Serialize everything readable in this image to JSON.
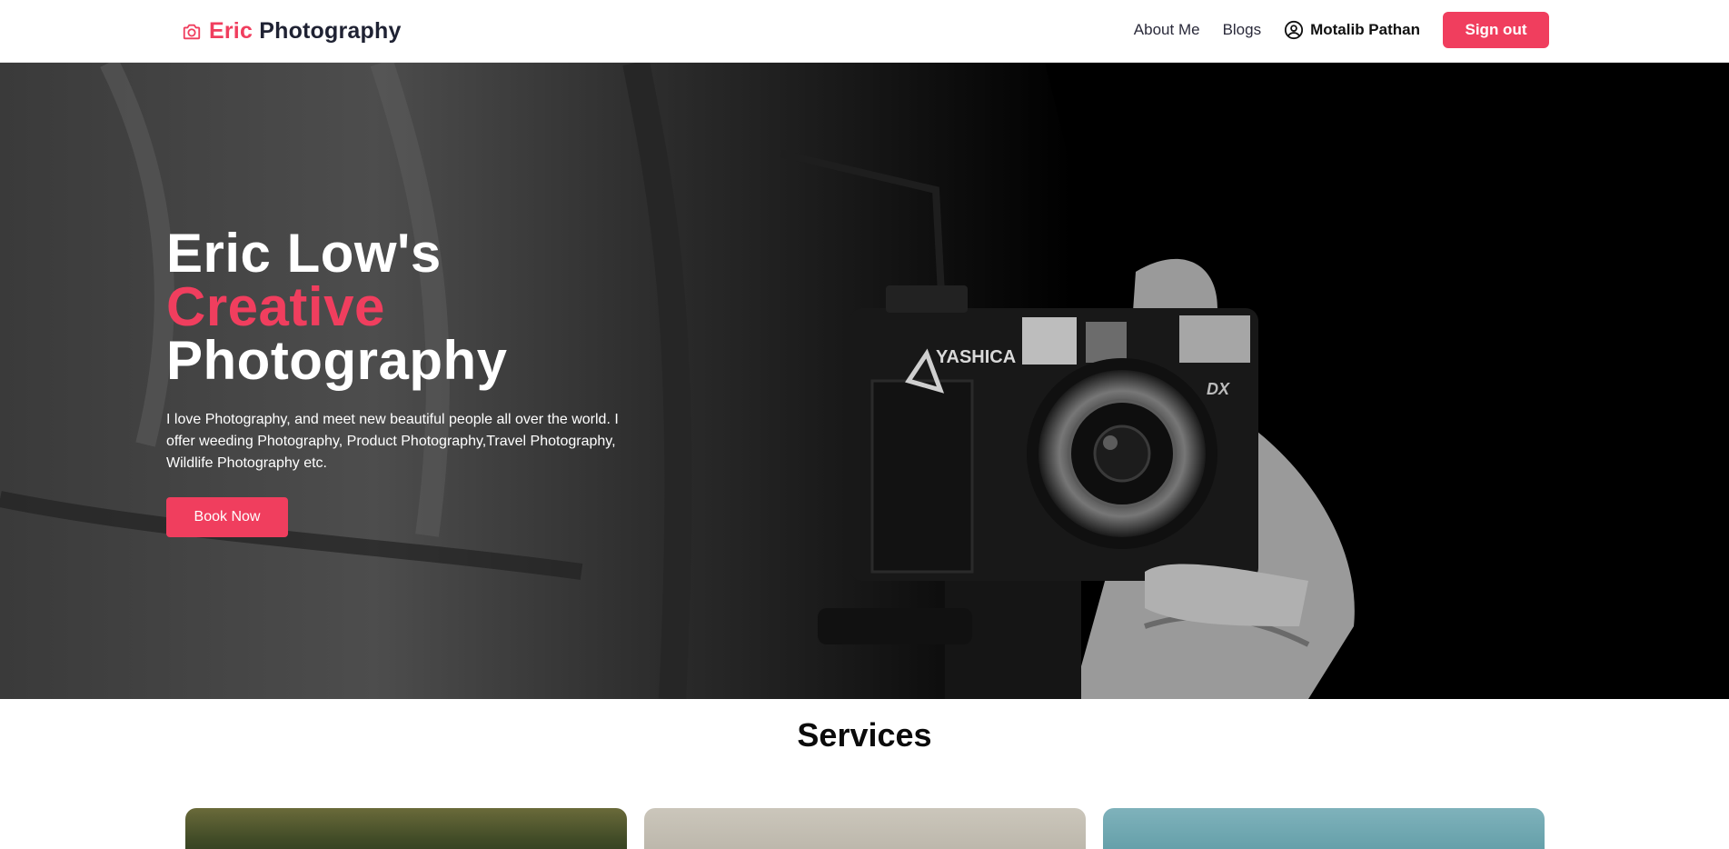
{
  "nav": {
    "brand_accent": "Eric",
    "brand_main": "Photography",
    "links": [
      "About Me",
      "Blogs"
    ],
    "user_name": "Motalib Pathan",
    "signout_label": "Sign out"
  },
  "hero": {
    "title_line1": "Eric Low's",
    "title_accent": "Creative",
    "title_line3": "Photography",
    "description": "I love Photography, and meet new beautiful people all over the world. I offer weeding Photography, Product Photography,Travel Photography, Wildlife Photography etc.",
    "cta_label": "Book Now",
    "camera_brand": "YASHICA",
    "camera_model": "DX"
  },
  "services": {
    "title": "Services"
  },
  "colors": {
    "accent": "#f03e5e",
    "text_dark": "#1f2233"
  },
  "icons": {
    "brand": "camera-icon",
    "user": "user-circle-icon"
  }
}
